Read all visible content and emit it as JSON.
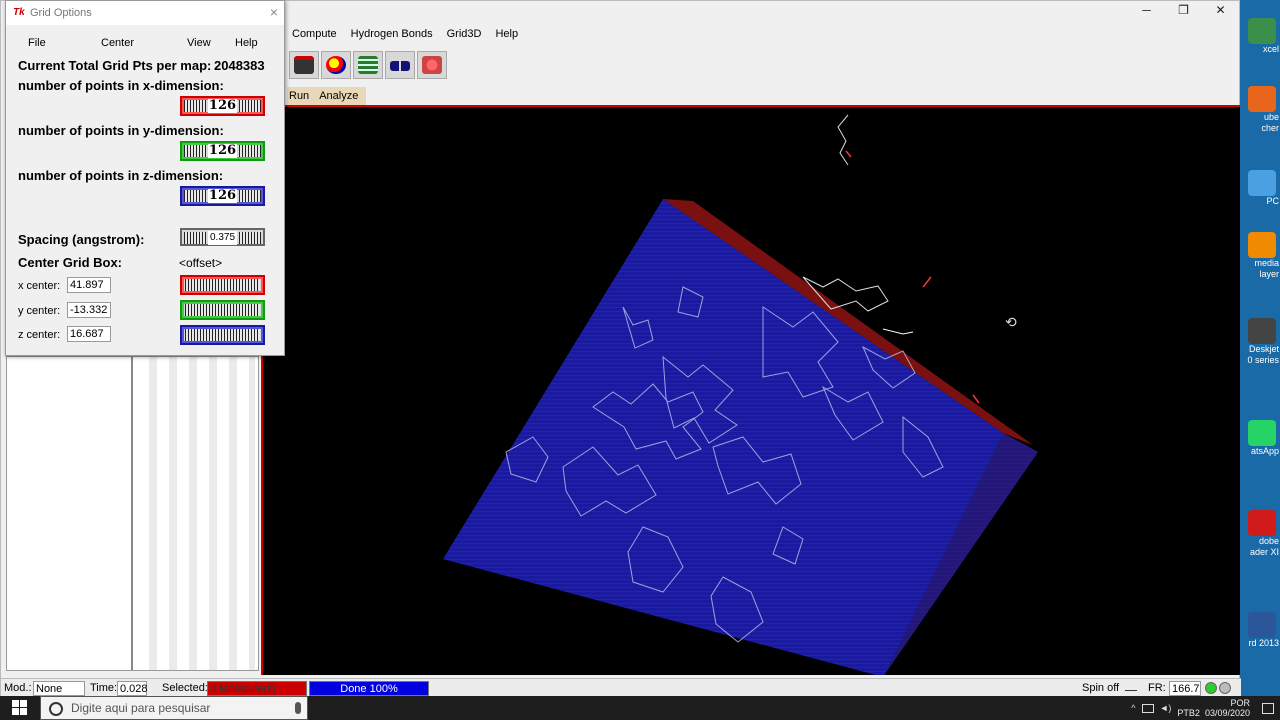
{
  "main_window": {
    "menu": [
      "Compute",
      "Hydrogen Bonds",
      "Grid3D",
      "Help"
    ],
    "subtabs": [
      "Run",
      "Analyze"
    ],
    "controls": {
      "minimize": "─",
      "maximize": "❐",
      "close": "✕"
    }
  },
  "grid_dialog": {
    "logo": "Tk",
    "title": "Grid Options",
    "close": "×",
    "menu": {
      "file": "File",
      "center": "Center",
      "view": "View",
      "help": "Help"
    },
    "total_label": "Current Total Grid Pts per map:",
    "total_value": "2048383",
    "x_label": "number of points in x-dimension:",
    "x_points": "126",
    "y_label": "number of points in y-dimension:",
    "y_points": "126",
    "z_label": "number of points in z-dimension:",
    "z_points": "126",
    "spacing_label": "Spacing (angstrom):",
    "spacing_value": "0.375",
    "center_box_label": "Center Grid Box:",
    "offset_label": "<offset>",
    "x_center_label": "x center:",
    "x_center_value": "41.897",
    "y_center_label": "y center:",
    "y_center_value": "-13.332",
    "z_center_label": "z center:",
    "z_center_value": "16.687"
  },
  "statusbar": {
    "mod_label": "Mod.:",
    "mod_value": "None",
    "time_label": "Time:",
    "time_value": "0.028",
    "selected_label": "Selected:",
    "selected_value": "0 Molecule(s)",
    "progress_text": "Done 100%",
    "progress_fraction": 1.0,
    "spin_label": "Spin off",
    "fr_label": "FR:",
    "fr_value": "166.7"
  },
  "desktop_icons": [
    {
      "label": "xcel",
      "color": "#3a8f4b"
    },
    {
      "label": "ube\ncher",
      "color": "#e8661c"
    },
    {
      "label": "PC",
      "color": "#4aa0e0"
    },
    {
      "label": "media\nlayer",
      "color": "#f08a00"
    },
    {
      "label": "Deskjet\n0 series",
      "color": "#444444"
    },
    {
      "label": "atsApp",
      "color": "#25d366"
    },
    {
      "label": "dobe\nader XI",
      "color": "#d11b1b"
    },
    {
      "label": "rd 2013",
      "color": "#2b579a"
    }
  ],
  "taskbar": {
    "search_placeholder": "Digite aqui para pesquisar",
    "apps": [
      "task-view",
      "file-explorer",
      "mail",
      "word",
      "acrobat",
      "whatsapp",
      "firefox",
      "chrome",
      "app-red",
      "terminal",
      "tk-app"
    ],
    "tray_lang": "POR",
    "tray_kb": "PTB2",
    "date": "03/09/2020"
  },
  "colors": {
    "accent_red": "#cc0000",
    "grid_blue": "#1a1aa8",
    "viewer_bg": "#000000"
  }
}
